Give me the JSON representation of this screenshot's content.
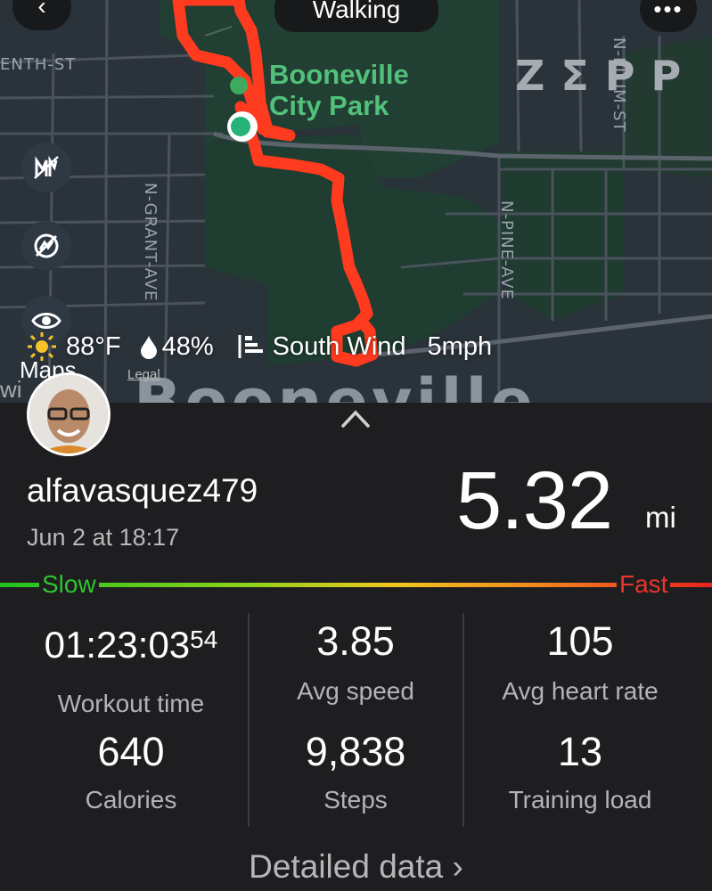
{
  "top_bar": {
    "back_icon": "chevron-left-icon",
    "mode": "Walking",
    "more_icon": "more-dots-icon"
  },
  "map": {
    "park_name_line1": "Booneville",
    "park_name_line2": "City Park",
    "brand_watermark": "ZΣPP",
    "streets": {
      "tenth": "ENTH-ST",
      "grant": "N-GRANT-AVE",
      "pine": "N-PINE-AVE",
      "plum": "N-PLUM-ST"
    },
    "town": "Booneville",
    "attribution": "Maps",
    "legal": "Legal",
    "wi": "wi",
    "side_buttons": [
      "mile-markers-icon",
      "route-hidden-icon",
      "eye-icon"
    ],
    "route_color": "#ff3b1f",
    "start_color": "#26b37a"
  },
  "weather": {
    "icon": "sun-icon",
    "temp": "88°F",
    "humidity_icon": "drop-icon",
    "humidity": "48%",
    "wind_icon": "wind-flag-icon",
    "wind": "South Wind",
    "wind_speed": "5mph"
  },
  "summary": {
    "username": "alfavasquez479",
    "datetime": "Jun 2 at 18:17",
    "distance": "5.32",
    "distance_unit": "mi"
  },
  "pace_scale": {
    "slow": "Slow",
    "fast": "Fast",
    "slow_color": "#2ec52e",
    "fast_color": "#e9352a"
  },
  "stats": {
    "workout_time_main": "01:23:03",
    "workout_time_sup": "54",
    "workout_time_label": "Workout time",
    "avg_speed": "3.85",
    "avg_speed_label": "Avg speed",
    "avg_hr": "105",
    "avg_hr_label": "Avg heart rate",
    "calories": "640",
    "calories_label": "Calories",
    "steps": "9,838",
    "steps_label": "Steps",
    "training_load": "13",
    "training_load_label": "Training load"
  },
  "footer": {
    "detailed": "Detailed data",
    "chevron": "›"
  }
}
